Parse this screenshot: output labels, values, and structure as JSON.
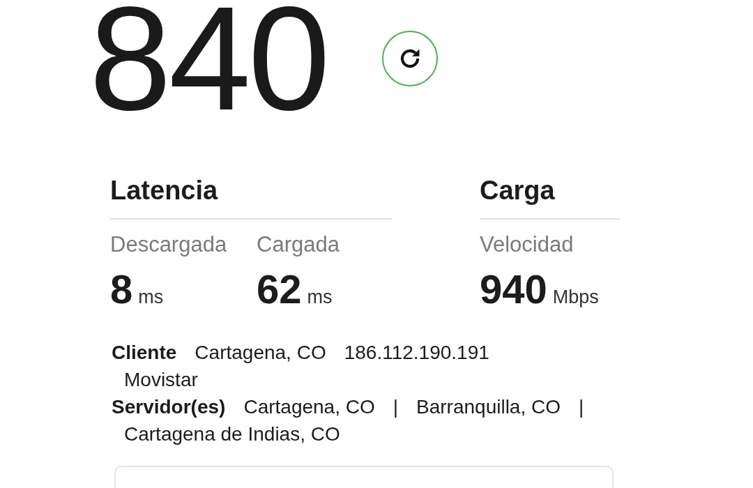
{
  "speed": {
    "value": "840"
  },
  "latency": {
    "title": "Latencia",
    "metrics": [
      {
        "label": "Descargada",
        "value": "8",
        "unit": "ms"
      },
      {
        "label": "Cargada",
        "value": "62",
        "unit": "ms"
      }
    ]
  },
  "upload": {
    "title": "Carga",
    "metrics": [
      {
        "label": "Velocidad",
        "value": "940",
        "unit": "Mbps"
      }
    ]
  },
  "info": [
    {
      "label": "Cliente",
      "lines": [
        [
          "Cartagena, CO",
          "186.112.190.191"
        ],
        [
          "Movistar"
        ]
      ]
    },
    {
      "label": "Servidor(es)",
      "lines": [
        [
          "Cartagena, CO",
          "|",
          "Barranquilla, CO",
          "|"
        ],
        [
          "Cartagena de Indias, CO"
        ]
      ]
    }
  ]
}
